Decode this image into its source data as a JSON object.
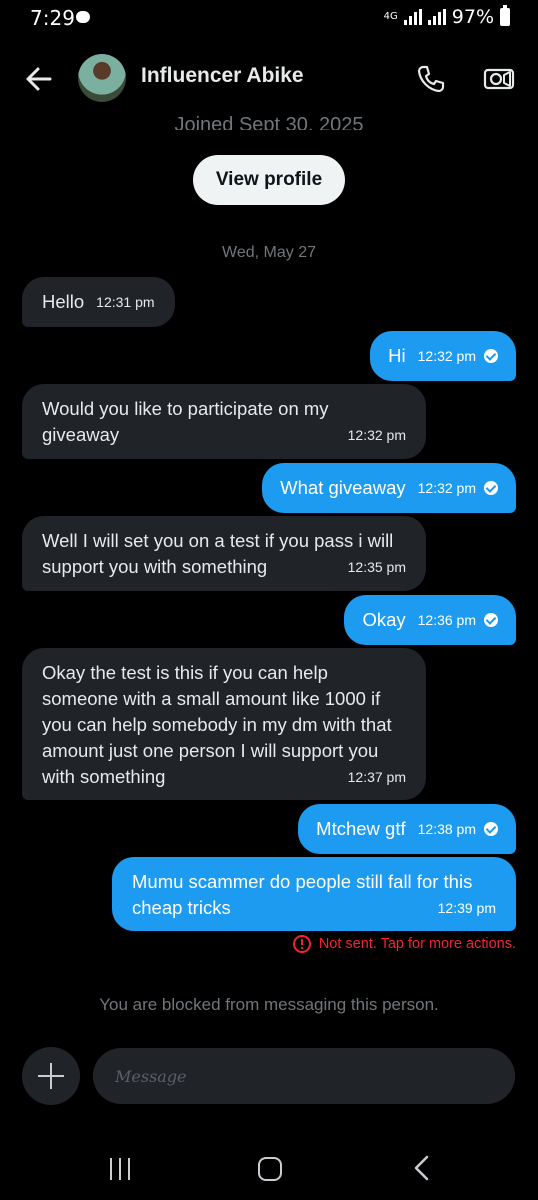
{
  "status_bar": {
    "time": "7:29",
    "network": "4G",
    "battery": "97%"
  },
  "header": {
    "contact_name": "Influencer Abike"
  },
  "profile": {
    "joined": "Joined Sept 30, 2025",
    "view_profile_label": "View profile"
  },
  "conversation": {
    "date_separator": "Wed, May 27",
    "messages": [
      {
        "direction": "in",
        "text": "Hello",
        "time": "12:31 pm"
      },
      {
        "direction": "out",
        "text": "Hi",
        "time": "12:32 pm",
        "status": "sent"
      },
      {
        "direction": "in",
        "lines": [
          "Would you like to participate on my",
          "giveaway"
        ],
        "time": "12:32 pm"
      },
      {
        "direction": "out",
        "text": "What giveaway",
        "time": "12:32 pm",
        "status": "sent"
      },
      {
        "direction": "in",
        "lines": [
          "Well I will set you on a test if you pass i will",
          "support you with something"
        ],
        "time": "12:35 pm"
      },
      {
        "direction": "out",
        "text": "Okay",
        "time": "12:36 pm",
        "status": "sent"
      },
      {
        "direction": "in",
        "lines": [
          "Okay the test is this if you can help",
          "someone with a small amount like 1000 if",
          "you can help somebody in my dm with that",
          "amount just one person I will support you",
          "with something"
        ],
        "time": "12:37 pm"
      },
      {
        "direction": "out",
        "text": "Mtchew gtf",
        "time": "12:38 pm",
        "status": "sent"
      },
      {
        "direction": "out",
        "lines": [
          "Mumu scammer do people still fall for this",
          "cheap tricks"
        ],
        "time": "12:39 pm",
        "status": "failed"
      }
    ],
    "not_sent_text": "Not sent. Tap for more actions."
  },
  "composer": {
    "blocked_text": "You are blocked from messaging this person.",
    "placeholder": "Message"
  },
  "colors": {
    "accent": "#1d9bf0",
    "incoming_bubble": "#202327",
    "error": "#f4212e",
    "muted": "#71767b"
  }
}
